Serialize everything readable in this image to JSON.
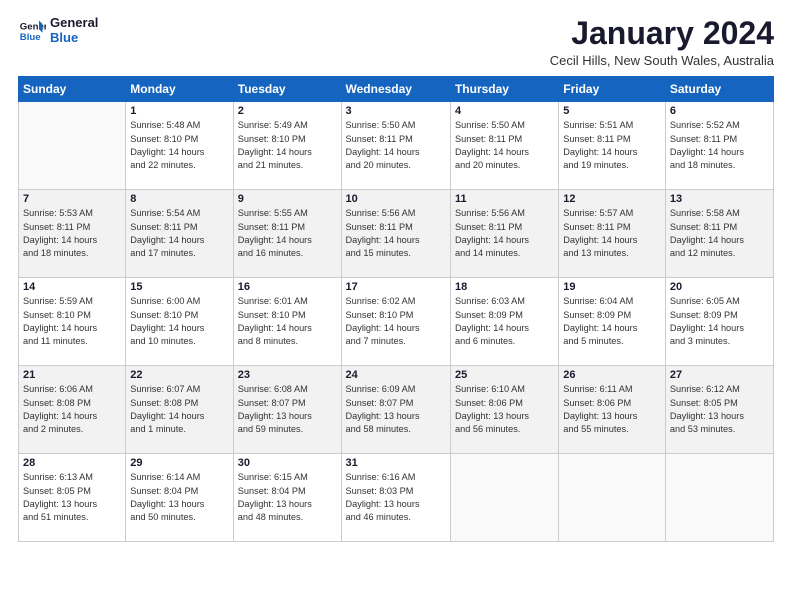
{
  "logo": {
    "line1": "General",
    "line2": "Blue"
  },
  "title": "January 2024",
  "location": "Cecil Hills, New South Wales, Australia",
  "days_of_week": [
    "Sunday",
    "Monday",
    "Tuesday",
    "Wednesday",
    "Thursday",
    "Friday",
    "Saturday"
  ],
  "weeks": [
    [
      {
        "num": "",
        "info": ""
      },
      {
        "num": "1",
        "info": "Sunrise: 5:48 AM\nSunset: 8:10 PM\nDaylight: 14 hours\nand 22 minutes."
      },
      {
        "num": "2",
        "info": "Sunrise: 5:49 AM\nSunset: 8:10 PM\nDaylight: 14 hours\nand 21 minutes."
      },
      {
        "num": "3",
        "info": "Sunrise: 5:50 AM\nSunset: 8:11 PM\nDaylight: 14 hours\nand 20 minutes."
      },
      {
        "num": "4",
        "info": "Sunrise: 5:50 AM\nSunset: 8:11 PM\nDaylight: 14 hours\nand 20 minutes."
      },
      {
        "num": "5",
        "info": "Sunrise: 5:51 AM\nSunset: 8:11 PM\nDaylight: 14 hours\nand 19 minutes."
      },
      {
        "num": "6",
        "info": "Sunrise: 5:52 AM\nSunset: 8:11 PM\nDaylight: 14 hours\nand 18 minutes."
      }
    ],
    [
      {
        "num": "7",
        "info": "Sunrise: 5:53 AM\nSunset: 8:11 PM\nDaylight: 14 hours\nand 18 minutes."
      },
      {
        "num": "8",
        "info": "Sunrise: 5:54 AM\nSunset: 8:11 PM\nDaylight: 14 hours\nand 17 minutes."
      },
      {
        "num": "9",
        "info": "Sunrise: 5:55 AM\nSunset: 8:11 PM\nDaylight: 14 hours\nand 16 minutes."
      },
      {
        "num": "10",
        "info": "Sunrise: 5:56 AM\nSunset: 8:11 PM\nDaylight: 14 hours\nand 15 minutes."
      },
      {
        "num": "11",
        "info": "Sunrise: 5:56 AM\nSunset: 8:11 PM\nDaylight: 14 hours\nand 14 minutes."
      },
      {
        "num": "12",
        "info": "Sunrise: 5:57 AM\nSunset: 8:11 PM\nDaylight: 14 hours\nand 13 minutes."
      },
      {
        "num": "13",
        "info": "Sunrise: 5:58 AM\nSunset: 8:11 PM\nDaylight: 14 hours\nand 12 minutes."
      }
    ],
    [
      {
        "num": "14",
        "info": "Sunrise: 5:59 AM\nSunset: 8:10 PM\nDaylight: 14 hours\nand 11 minutes."
      },
      {
        "num": "15",
        "info": "Sunrise: 6:00 AM\nSunset: 8:10 PM\nDaylight: 14 hours\nand 10 minutes."
      },
      {
        "num": "16",
        "info": "Sunrise: 6:01 AM\nSunset: 8:10 PM\nDaylight: 14 hours\nand 8 minutes."
      },
      {
        "num": "17",
        "info": "Sunrise: 6:02 AM\nSunset: 8:10 PM\nDaylight: 14 hours\nand 7 minutes."
      },
      {
        "num": "18",
        "info": "Sunrise: 6:03 AM\nSunset: 8:09 PM\nDaylight: 14 hours\nand 6 minutes."
      },
      {
        "num": "19",
        "info": "Sunrise: 6:04 AM\nSunset: 8:09 PM\nDaylight: 14 hours\nand 5 minutes."
      },
      {
        "num": "20",
        "info": "Sunrise: 6:05 AM\nSunset: 8:09 PM\nDaylight: 14 hours\nand 3 minutes."
      }
    ],
    [
      {
        "num": "21",
        "info": "Sunrise: 6:06 AM\nSunset: 8:08 PM\nDaylight: 14 hours\nand 2 minutes."
      },
      {
        "num": "22",
        "info": "Sunrise: 6:07 AM\nSunset: 8:08 PM\nDaylight: 14 hours\nand 1 minute."
      },
      {
        "num": "23",
        "info": "Sunrise: 6:08 AM\nSunset: 8:07 PM\nDaylight: 13 hours\nand 59 minutes."
      },
      {
        "num": "24",
        "info": "Sunrise: 6:09 AM\nSunset: 8:07 PM\nDaylight: 13 hours\nand 58 minutes."
      },
      {
        "num": "25",
        "info": "Sunrise: 6:10 AM\nSunset: 8:06 PM\nDaylight: 13 hours\nand 56 minutes."
      },
      {
        "num": "26",
        "info": "Sunrise: 6:11 AM\nSunset: 8:06 PM\nDaylight: 13 hours\nand 55 minutes."
      },
      {
        "num": "27",
        "info": "Sunrise: 6:12 AM\nSunset: 8:05 PM\nDaylight: 13 hours\nand 53 minutes."
      }
    ],
    [
      {
        "num": "28",
        "info": "Sunrise: 6:13 AM\nSunset: 8:05 PM\nDaylight: 13 hours\nand 51 minutes."
      },
      {
        "num": "29",
        "info": "Sunrise: 6:14 AM\nSunset: 8:04 PM\nDaylight: 13 hours\nand 50 minutes."
      },
      {
        "num": "30",
        "info": "Sunrise: 6:15 AM\nSunset: 8:04 PM\nDaylight: 13 hours\nand 48 minutes."
      },
      {
        "num": "31",
        "info": "Sunrise: 6:16 AM\nSunset: 8:03 PM\nDaylight: 13 hours\nand 46 minutes."
      },
      {
        "num": "",
        "info": ""
      },
      {
        "num": "",
        "info": ""
      },
      {
        "num": "",
        "info": ""
      }
    ]
  ]
}
